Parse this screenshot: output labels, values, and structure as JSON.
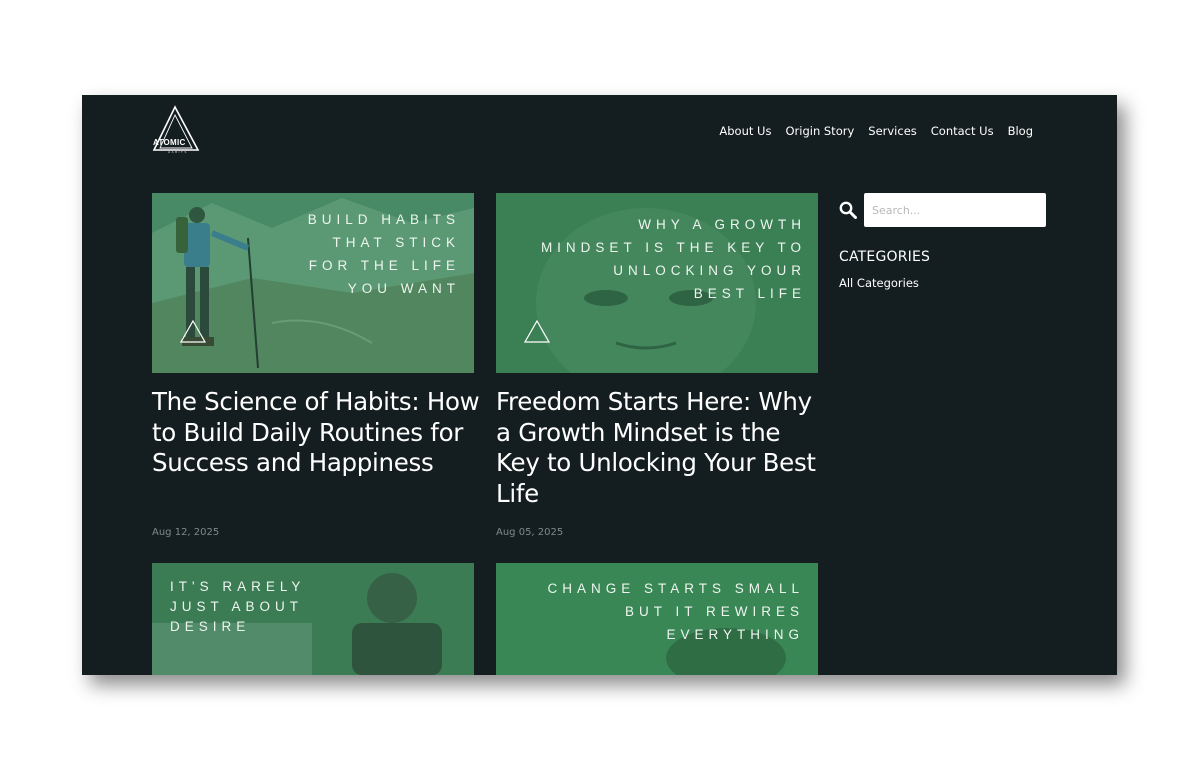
{
  "brand": {
    "logo_text": "ATOMIC",
    "logo_sub": "HABITS"
  },
  "nav": {
    "items": [
      {
        "label": "About Us"
      },
      {
        "label": "Origin Story"
      },
      {
        "label": "Services"
      },
      {
        "label": "Contact Us"
      },
      {
        "label": "Blog"
      }
    ]
  },
  "posts": [
    {
      "image_text": [
        "BUILD HABITS",
        "THAT STICK",
        "FOR THE LIFE",
        "YOU WANT"
      ],
      "title": "The Science of Habits: How to Build Daily Routines for Success and Happiness",
      "date": "Aug 12, 2025"
    },
    {
      "image_text": [
        "WHY A GROWTH",
        "MINDSET IS THE KEY TO",
        "UNLOCKING YOUR",
        "BEST LIFE"
      ],
      "title": "Freedom Starts Here: Why a Growth Mindset is the Key to Unlocking Your Best Life",
      "date": "Aug 05, 2025"
    },
    {
      "image_text": [
        "IT'S RARELY",
        "JUST ABOUT",
        "DESIRE"
      ]
    },
    {
      "image_text": [
        "CHANGE STARTS SMALL",
        "BUT IT REWIRES",
        "EVERYTHING"
      ]
    }
  ],
  "sidebar": {
    "search_placeholder": "Search...",
    "categories_heading": "CATEGORIES",
    "category_link": "All Categories"
  },
  "colors": {
    "background": "#141d1f",
    "image_tint": "#2f7a4f",
    "date_text": "#7e8a8a"
  }
}
